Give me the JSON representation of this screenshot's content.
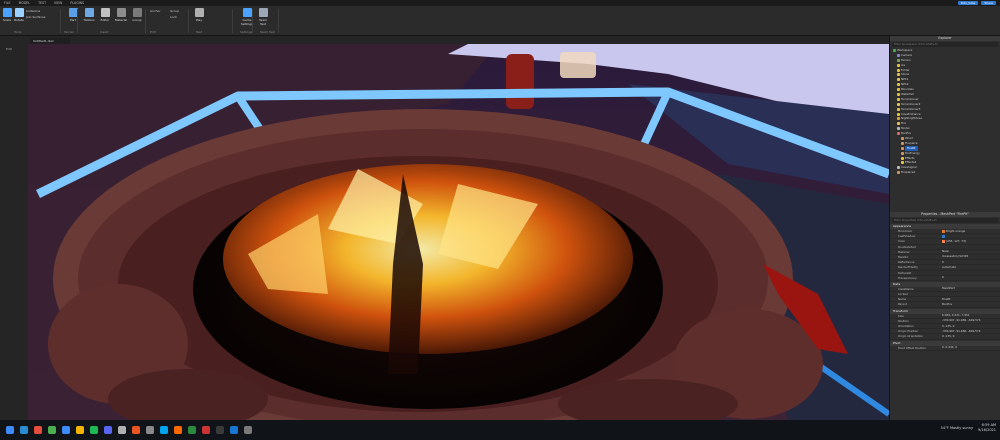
{
  "menu": {
    "items": [
      "FILE",
      "MODEL",
      "TEST",
      "VIEW",
      "PLUGINS"
    ],
    "user_badge": "Ddn_tube",
    "share_label": "Share"
  },
  "ribbon": {
    "buttons": [
      {
        "label": "Scale",
        "color": "#4aa3ff"
      },
      {
        "label": "Rotate",
        "color": "#9bd1ff"
      },
      {
        "label": "Part",
        "color": "#5aa0e8"
      },
      {
        "label": "Toolbox",
        "color": "#6ea9e6"
      },
      {
        "label": "Editor",
        "color": "#c1c1c1"
      },
      {
        "label": "Material",
        "color": "#8d8d8d"
      },
      {
        "label": "Group",
        "color": "#7a7a7a"
      },
      {
        "label": "Play",
        "color": "#b0b0b0"
      },
      {
        "label": "Game Settings",
        "color": "#4aa3ff"
      },
      {
        "label": "Team Test",
        "color": "#9ba7b4"
      }
    ],
    "small_items": [
      "Collisions",
      "Join Surfaces",
      "Anchor",
      "Group",
      "Lock"
    ],
    "groups": [
      "Tools",
      "Terrain",
      "Insert",
      "Edit",
      "Test",
      "Settings",
      "Team Test"
    ]
  },
  "tab": {
    "label": "Untitled1.rbxl"
  },
  "left_panel": {
    "label": "Edit"
  },
  "explorer": {
    "title": "Explorer",
    "filter_placeholder": "Filter workspace (Ctrl+Shift+X)",
    "items": [
      {
        "label": "Workspace",
        "indent": 0,
        "color": "#4caf50"
      },
      {
        "label": "Camera",
        "indent": 1,
        "color": "#88c"
      },
      {
        "label": "Terrain",
        "indent": 1,
        "color": "#7a5"
      },
      {
        "label": "Ice",
        "indent": 1,
        "color": "#e8c34a"
      },
      {
        "label": "Folder",
        "indent": 1,
        "color": "#e8c34a"
      },
      {
        "label": "Stone",
        "indent": 1,
        "color": "#e8c34a"
      },
      {
        "label": "NPC1",
        "indent": 1,
        "color": "#e8c34a"
      },
      {
        "label": "NPC2",
        "indent": 1,
        "color": "#e8c34a"
      },
      {
        "label": "Mountain",
        "indent": 1,
        "color": "#e8c34a"
      },
      {
        "label": "Waterfall",
        "indent": 1,
        "color": "#e8c34a"
      },
      {
        "label": "TerrainCover",
        "indent": 1,
        "color": "#e8c34a"
      },
      {
        "label": "TerrainCover2",
        "indent": 1,
        "color": "#e8c34a"
      },
      {
        "label": "TerrainCover3",
        "indent": 1,
        "color": "#e8c34a"
      },
      {
        "label": "CaveEntrance",
        "indent": 1,
        "color": "#e8c34a"
      },
      {
        "label": "NightLightArea",
        "indent": 1,
        "color": "#d9a441"
      },
      {
        "label": "Fire",
        "indent": 1,
        "color": "#e8c34a"
      },
      {
        "label": "Model",
        "indent": 1,
        "color": "#bbb"
      },
      {
        "label": "Bonfire",
        "indent": 1,
        "color": "#d96b6b"
      },
      {
        "label": "Wood",
        "indent": 2,
        "color": "#c96"
      },
      {
        "label": "Fireplace",
        "indent": 2,
        "color": "#c96"
      },
      {
        "label": "FirePit",
        "indent": 2,
        "color": "#c96",
        "selected": true
      },
      {
        "label": "FireEnergy",
        "indent": 2,
        "color": "#c96"
      },
      {
        "label": "Effects",
        "indent": 2,
        "color": "#e8c34a"
      },
      {
        "label": "Effects2",
        "indent": 2,
        "color": "#e8c34a"
      },
      {
        "label": "CaveSignal",
        "indent": 1,
        "color": "#bbb"
      },
      {
        "label": "Fireplace2",
        "indent": 1,
        "color": "#c96"
      }
    ]
  },
  "properties": {
    "title": "Properties - MeshPart \"FirePit\"",
    "filter_placeholder": "Filter Properties (Ctrl+Shift+P)",
    "sections": [
      {
        "name": "Appearance",
        "rows": [
          {
            "name": "BrickColor",
            "value": "Bright orange",
            "swatch": "#e8742a"
          },
          {
            "name": "CastShadow",
            "value": "",
            "check": true
          },
          {
            "name": "Color",
            "value": "[255, 127, 73]",
            "swatch": "#ff7f49"
          },
          {
            "name": "DoubleSided",
            "value": ""
          },
          {
            "name": "Material",
            "value": "Neon"
          },
          {
            "name": "MeshId",
            "value": "rbxassetid://12345"
          },
          {
            "name": "Reflectance",
            "value": "0"
          },
          {
            "name": "RenderFidelity",
            "value": "Automatic"
          },
          {
            "name": "TextureID",
            "value": ""
          },
          {
            "name": "Transparency",
            "value": "0"
          }
        ]
      },
      {
        "name": "Data",
        "rows": [
          {
            "name": "ClassName",
            "value": "MeshPart"
          },
          {
            "name": "Locked",
            "value": ""
          },
          {
            "name": "Name",
            "value": "FirePit"
          },
          {
            "name": "Parent",
            "value": "Bonfire"
          }
        ]
      },
      {
        "name": "Transform",
        "rows": [
          {
            "name": "Size",
            "value": "6.069, 0.221, 7.951"
          },
          {
            "name": "Position",
            "value": "-330.907, 91.486, -649.574"
          },
          {
            "name": "Orientation",
            "value": "0, 135, 0"
          },
          {
            "name": "Origin Position",
            "value": "-330.907, 91.486, -649.574"
          },
          {
            "name": "Origin Orientation",
            "value": "0, 135, 0"
          }
        ]
      },
      {
        "name": "Pivot",
        "rows": [
          {
            "name": "Pivot Offset Position",
            "value": "0, 0.444, 0"
          }
        ]
      }
    ]
  },
  "taskbar": {
    "weather": "54°F Mostly sunny",
    "time": "6:59 AM",
    "date": "9/16/2021",
    "icons": [
      "#2a8dd4",
      "#e84c3d",
      "#4caf50",
      "#3d8bfd",
      "#f4b400",
      "#1db954",
      "#5865f2",
      "#b0b0b0",
      "#e95420",
      "#8a8a8a",
      "#00a4ef",
      "#ff6a00",
      "#2b8a3e",
      "#cc3333",
      "#3a3a3a",
      "#1976d2",
      "#7a7a7a"
    ]
  }
}
